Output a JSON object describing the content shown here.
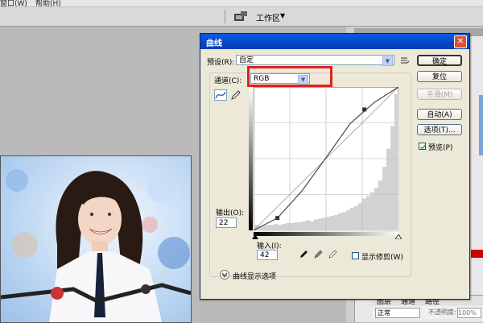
{
  "menubar": {
    "item1": "窗口(W)",
    "item2": "帮助(H)"
  },
  "optionsbar": {
    "workspace_label": "工作区",
    "workspace_arrow": "▼"
  },
  "right_panel": {
    "layers_tabs": [
      "图层",
      "通道",
      "路径"
    ],
    "blend_mode": "正常",
    "opacity_label": "不透明度:",
    "opacity_value": "100%"
  },
  "dialog": {
    "title": "曲线",
    "close": "✕",
    "preset_label": "预设(R):",
    "preset_value": "自定",
    "channel_label": "通道(C):",
    "channel_value": "RGB",
    "output_label": "输出(O):",
    "output_value": "22",
    "input_label": "输入(I):",
    "input_value": "42",
    "show_clipping": "显示修剪(W)",
    "curve_display_options": "曲线显示选项",
    "buttons": {
      "ok": "确定",
      "reset": "复位",
      "smooth": "平滑(M)",
      "auto": "自动(A)",
      "options": "选项(T)...",
      "preview": "预览(P)"
    },
    "preview_checked": true
  },
  "chart_data": {
    "type": "line",
    "title": "",
    "xlabel": "输入(I)",
    "ylabel": "输出(O)",
    "xlim": [
      0,
      255
    ],
    "ylim": [
      0,
      255
    ],
    "grid": true,
    "series": [
      {
        "values_x": [
          0,
          42,
          85,
          128,
          170,
          213,
          255
        ],
        "values_y": [
          0,
          22,
          70,
          130,
          190,
          228,
          255
        ]
      }
    ],
    "baseline": {
      "values_x": [
        0,
        255
      ],
      "values_y": [
        0,
        255
      ]
    },
    "control_points": [
      {
        "x": 42,
        "y": 22
      },
      {
        "x": 195,
        "y": 215
      }
    ],
    "histogram": [
      6,
      5,
      5,
      6,
      6,
      7,
      6,
      7,
      8,
      8,
      9,
      9,
      10,
      11,
      10,
      12,
      13,
      14,
      15,
      16,
      17,
      19,
      20,
      22,
      25,
      27,
      30,
      35,
      38,
      42,
      47,
      55,
      70,
      90,
      115,
      150
    ],
    "colors": {
      "curve": "#4a4a4a",
      "histogram": "#d2d2d2",
      "grid": "#b5b5b5"
    }
  }
}
